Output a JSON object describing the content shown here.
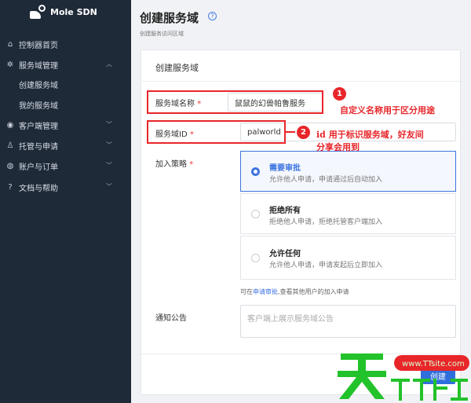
{
  "app": {
    "logo_text": "Mole SDN"
  },
  "sidebar": {
    "items": [
      {
        "label": "控制器首页",
        "icon": "home-icon",
        "glyph": "⌂"
      },
      {
        "label": "服务域管理",
        "icon": "cluster-icon",
        "glyph": "✲"
      },
      {
        "label": "创建服务域"
      },
      {
        "label": "我的服务域"
      },
      {
        "label": "客户端管理",
        "icon": "client-icon",
        "glyph": "◉"
      },
      {
        "label": "托管与申请",
        "icon": "hosting-icon",
        "glyph": "♙"
      },
      {
        "label": "账户与订单",
        "icon": "account-icon",
        "glyph": "◍"
      },
      {
        "label": "文档与帮助",
        "icon": "help-icon",
        "glyph": "?"
      }
    ]
  },
  "page": {
    "title": "创建服务域",
    "help_glyph": "?",
    "subtitle": "创建服务访问区域"
  },
  "form": {
    "card_title": "创建服务域",
    "name_label": "服务域名称",
    "name_value": "鼠鼠的幻兽帕鲁服务",
    "id_label": "服务域ID",
    "id_value": "palworld",
    "required_mark": "*",
    "policy_label": "加入策略",
    "policy_options": [
      {
        "title": "需要审批",
        "desc": "允许他人申请，申请通过后自动加入",
        "selected": true
      },
      {
        "title": "拒绝所有",
        "desc": "拒绝他人申请，拒绝托管客户端加入",
        "selected": false
      },
      {
        "title": "允许任何",
        "desc": "允许他人申请，申请发起后立即加入",
        "selected": false
      }
    ],
    "hint_prefix": "可在",
    "hint_link": "申请审批",
    "hint_suffix": ",查看其他用户的加入申请",
    "notice_label": "通知公告",
    "notice_placeholder": "客户端上展示服务域公告",
    "create_button": "创建"
  },
  "annotations": {
    "n1": "1",
    "n2": "2",
    "t1": "自定义名称用于区分用途",
    "t2_line1": "id 用于标识服务域，好友间",
    "t2_line2": "分享会用到"
  },
  "colors": {
    "sidebar": "#1f2a38",
    "accent": "#3d74e0",
    "annotation": "#e8262a"
  }
}
